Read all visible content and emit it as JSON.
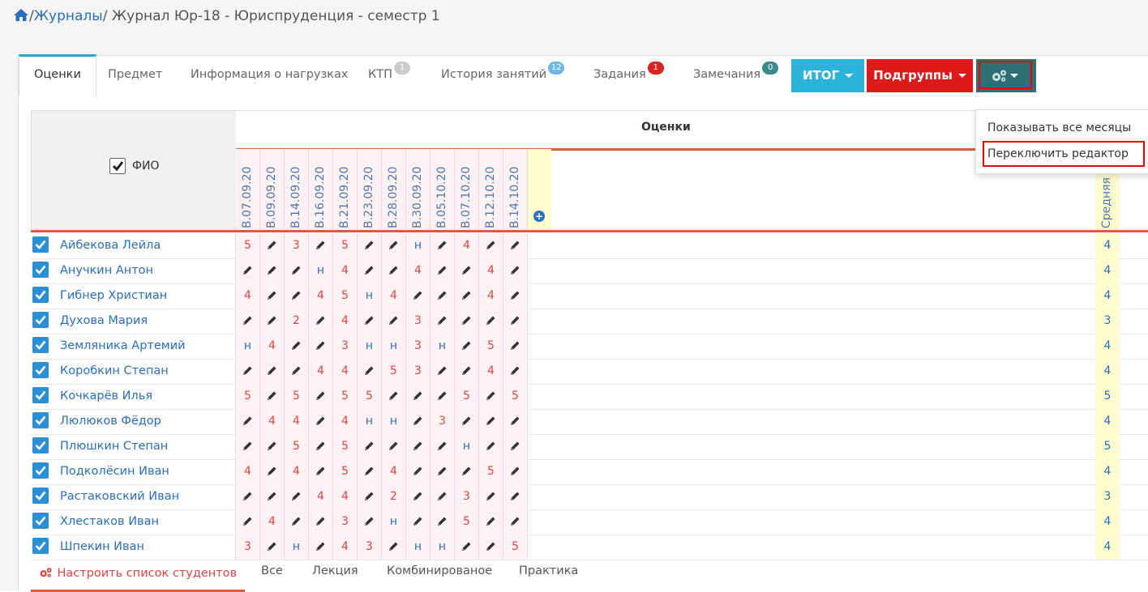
{
  "breadcrumb": {
    "sep1": "/",
    "journals": "Журналы",
    "sep2": "/",
    "current": "Журнал Юр-18 - Юриспруденция - семестр 1"
  },
  "tabs": [
    {
      "label": "Оценки",
      "badge": ""
    },
    {
      "label": "Предмет",
      "badge": ""
    },
    {
      "label": "Информация о нагрузках",
      "badge": ""
    },
    {
      "label": "КТП",
      "badge": "1"
    },
    {
      "label": "История занятий",
      "badge": "12"
    },
    {
      "label": "Задания",
      "badge": "1"
    },
    {
      "label": "Замечания",
      "badge": "0"
    }
  ],
  "buttons": {
    "itog": "ИТОГ",
    "podgruppy": "Подгруппы"
  },
  "dropdown": {
    "item1": "Показывать все месяцы",
    "item2": "Переключить редактор"
  },
  "grid": {
    "header_title": "Оценки",
    "fio_label": "ФИО",
    "dates": [
      "В.07.09.20",
      "В.09.09.20",
      "В.14.09.20",
      "В.16.09.20",
      "В.21.09.20",
      "В.23.09.20",
      "В.28.09.20",
      "В.30.09.20",
      "В.05.10.20",
      "В.07.10.20",
      "В.12.10.20",
      "В.14.10.20"
    ],
    "avg_label": "Средняя",
    "students": [
      {
        "name": "Айбекова Лейла",
        "marks": [
          "5",
          "e",
          "3",
          "e",
          "5",
          "e",
          "e",
          "н",
          "e",
          "4",
          "e",
          "e"
        ],
        "avg": "4"
      },
      {
        "name": "Анучкин Антон",
        "marks": [
          "e",
          "e",
          "e",
          "н",
          "4",
          "e",
          "e",
          "4",
          "e",
          "e",
          "4",
          "e"
        ],
        "avg": "4"
      },
      {
        "name": "Гибнер Христиан",
        "marks": [
          "4",
          "e",
          "e",
          "4",
          "5",
          "н",
          "4",
          "e",
          "e",
          "e",
          "4",
          "e"
        ],
        "avg": "4"
      },
      {
        "name": "Духова Мария",
        "marks": [
          "e",
          "e",
          "2",
          "e",
          "4",
          "e",
          "e",
          "3",
          "e",
          "e",
          "e",
          "e"
        ],
        "avg": "3"
      },
      {
        "name": "Земляника Артемий",
        "marks": [
          "н",
          "4",
          "e",
          "e",
          "3",
          "н",
          "н",
          "3",
          "н",
          "e",
          "5",
          "e"
        ],
        "avg": "4"
      },
      {
        "name": "Коробкин Степан",
        "marks": [
          "e",
          "e",
          "e",
          "4",
          "4",
          "e",
          "5",
          "3",
          "e",
          "e",
          "4",
          "e"
        ],
        "avg": "4"
      },
      {
        "name": "Кочкарёв Илья",
        "marks": [
          "5",
          "e",
          "5",
          "e",
          "5",
          "5",
          "e",
          "e",
          "e",
          "5",
          "e",
          "5"
        ],
        "avg": "5"
      },
      {
        "name": "Люлюков Фёдор",
        "marks": [
          "e",
          "4",
          "4",
          "e",
          "4",
          "н",
          "н",
          "e",
          "3",
          "e",
          "e",
          "e"
        ],
        "avg": "4"
      },
      {
        "name": "Плюшкин Степан",
        "marks": [
          "e",
          "e",
          "5",
          "e",
          "5",
          "e",
          "e",
          "e",
          "e",
          "н",
          "e",
          "e"
        ],
        "avg": "5"
      },
      {
        "name": "Подколёсин Иван",
        "marks": [
          "4",
          "e",
          "4",
          "e",
          "5",
          "e",
          "4",
          "e",
          "e",
          "e",
          "5",
          "e"
        ],
        "avg": "4"
      },
      {
        "name": "Растаковский Иван",
        "marks": [
          "e",
          "e",
          "e",
          "4",
          "4",
          "e",
          "2",
          "e",
          "e",
          "3",
          "e",
          "e"
        ],
        "avg": "3"
      },
      {
        "name": "Хлестаков Иван",
        "marks": [
          "e",
          "4",
          "e",
          "e",
          "3",
          "e",
          "н",
          "e",
          "e",
          "5",
          "e",
          "e"
        ],
        "avg": "4"
      },
      {
        "name": "Шпекин Иван",
        "marks": [
          "3",
          "e",
          "н",
          "e",
          "4",
          "3",
          "e",
          "н",
          "н",
          "e",
          "e",
          "5"
        ],
        "avg": "4"
      }
    ]
  },
  "footer": {
    "configure": "Настроить список студентов",
    "tabs": [
      "Все",
      "Лекция",
      "Комбинированое",
      "Практика"
    ]
  },
  "colors": {
    "accent": "#e05a3c",
    "itog": "#2bb3d9",
    "podgruppy": "#dd1a1a",
    "gear": "#2e6f73",
    "link": "#2a6ebb"
  }
}
